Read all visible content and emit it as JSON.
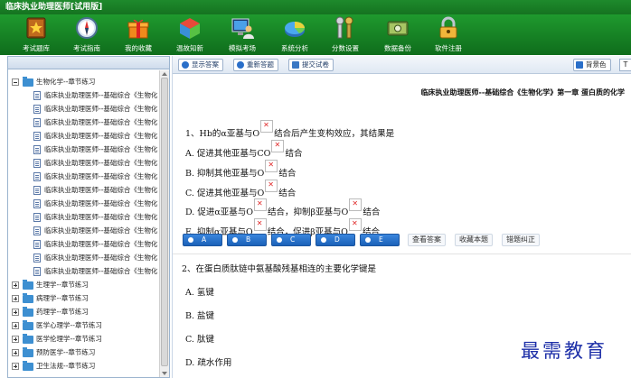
{
  "window": {
    "title": "临床执业助理医师[试用版]"
  },
  "toolbar": {
    "items": [
      {
        "label": "考试题库",
        "icon": "book-star-icon"
      },
      {
        "label": "考试指南",
        "icon": "compass-icon"
      },
      {
        "label": "我的收藏",
        "icon": "gift-box-icon"
      },
      {
        "label": "温故知新",
        "icon": "cube-icon"
      },
      {
        "label": "模拟考场",
        "icon": "computer-user-icon"
      },
      {
        "label": "系统分析",
        "icon": "pie-chart-icon"
      },
      {
        "label": "分数设置",
        "icon": "wrench-icon"
      },
      {
        "label": "数据备份",
        "icon": "data-disk-icon"
      },
      {
        "label": "软件注册",
        "icon": "lock-icon"
      }
    ]
  },
  "tree": {
    "root": "生物化学--章节练习",
    "children": [
      "临床执业助理医师--基础综合《生物化",
      "临床执业助理医师--基础综合《生物化",
      "临床执业助理医师--基础综合《生物化",
      "临床执业助理医师--基础综合《生物化",
      "临床执业助理医师--基础综合《生物化",
      "临床执业助理医师--基础综合《生物化",
      "临床执业助理医师--基础综合《生物化",
      "临床执业助理医师--基础综合《生物化",
      "临床执业助理医师--基础综合《生物化",
      "临床执业助理医师--基础综合《生物化",
      "临床执业助理医师--基础综合《生物化",
      "临床执业助理医师--基础综合《生物化",
      "临床执业助理医师--基础综合《生物化",
      "临床执业助理医师--基础综合《生物化"
    ],
    "siblings": [
      "生理学--章节练习",
      "病理学--章节练习",
      "药理学--章节练习",
      "医学心理学--章节练习",
      "医学伦理学--章节练习",
      "预防医学--章节练习",
      "卫生法规--章节练习"
    ]
  },
  "actions": {
    "show_answer": "显示答案",
    "restart": "重新答题",
    "submit": "提交试卷",
    "skin": "背景色",
    "t": "T"
  },
  "paper": {
    "title": "临床执业助理医师--基础综合《生物化学》第一章  蛋白质的化学"
  },
  "q1": {
    "stem_a": "1、Hb的α亚基与O",
    "stem_b": "结合后产生变构效应，其结果是",
    "options": [
      {
        "pre": "A. 促进其他亚基与CO",
        "post": "结合",
        "img2": false
      },
      {
        "pre": "B. 抑制其他亚基与O",
        "post": "结合",
        "img2": false
      },
      {
        "pre": "C. 促进其他亚基与O",
        "post": "结合",
        "img2": false
      },
      {
        "pre": "D. 促进α亚基与O",
        "mid": "结合，抑制β亚基与O",
        "post": "结合",
        "img2": true
      },
      {
        "pre": "E. 抑制α亚基与O",
        "mid": "结合，促进β亚基与O",
        "post": "结合",
        "img2": true
      }
    ],
    "answer_buttons": [
      "A",
      "B",
      "C",
      "D",
      "E"
    ],
    "view_answer": "查看答案",
    "bookmark": "收藏本题",
    "report_error": "错题纠正"
  },
  "q2": {
    "stem": "2、在蛋白质肽链中氨基酸残基相连的主要化学键是",
    "options": [
      "A. 氢键",
      "B. 盐键",
      "C. 肽键",
      "D. 疏水作用"
    ]
  },
  "watermark": "最需教育",
  "colors": {
    "toolbar_green": "#1f9a2e",
    "option_blue": "#2a78d6",
    "watermark_blue": "#1d2fa8"
  }
}
